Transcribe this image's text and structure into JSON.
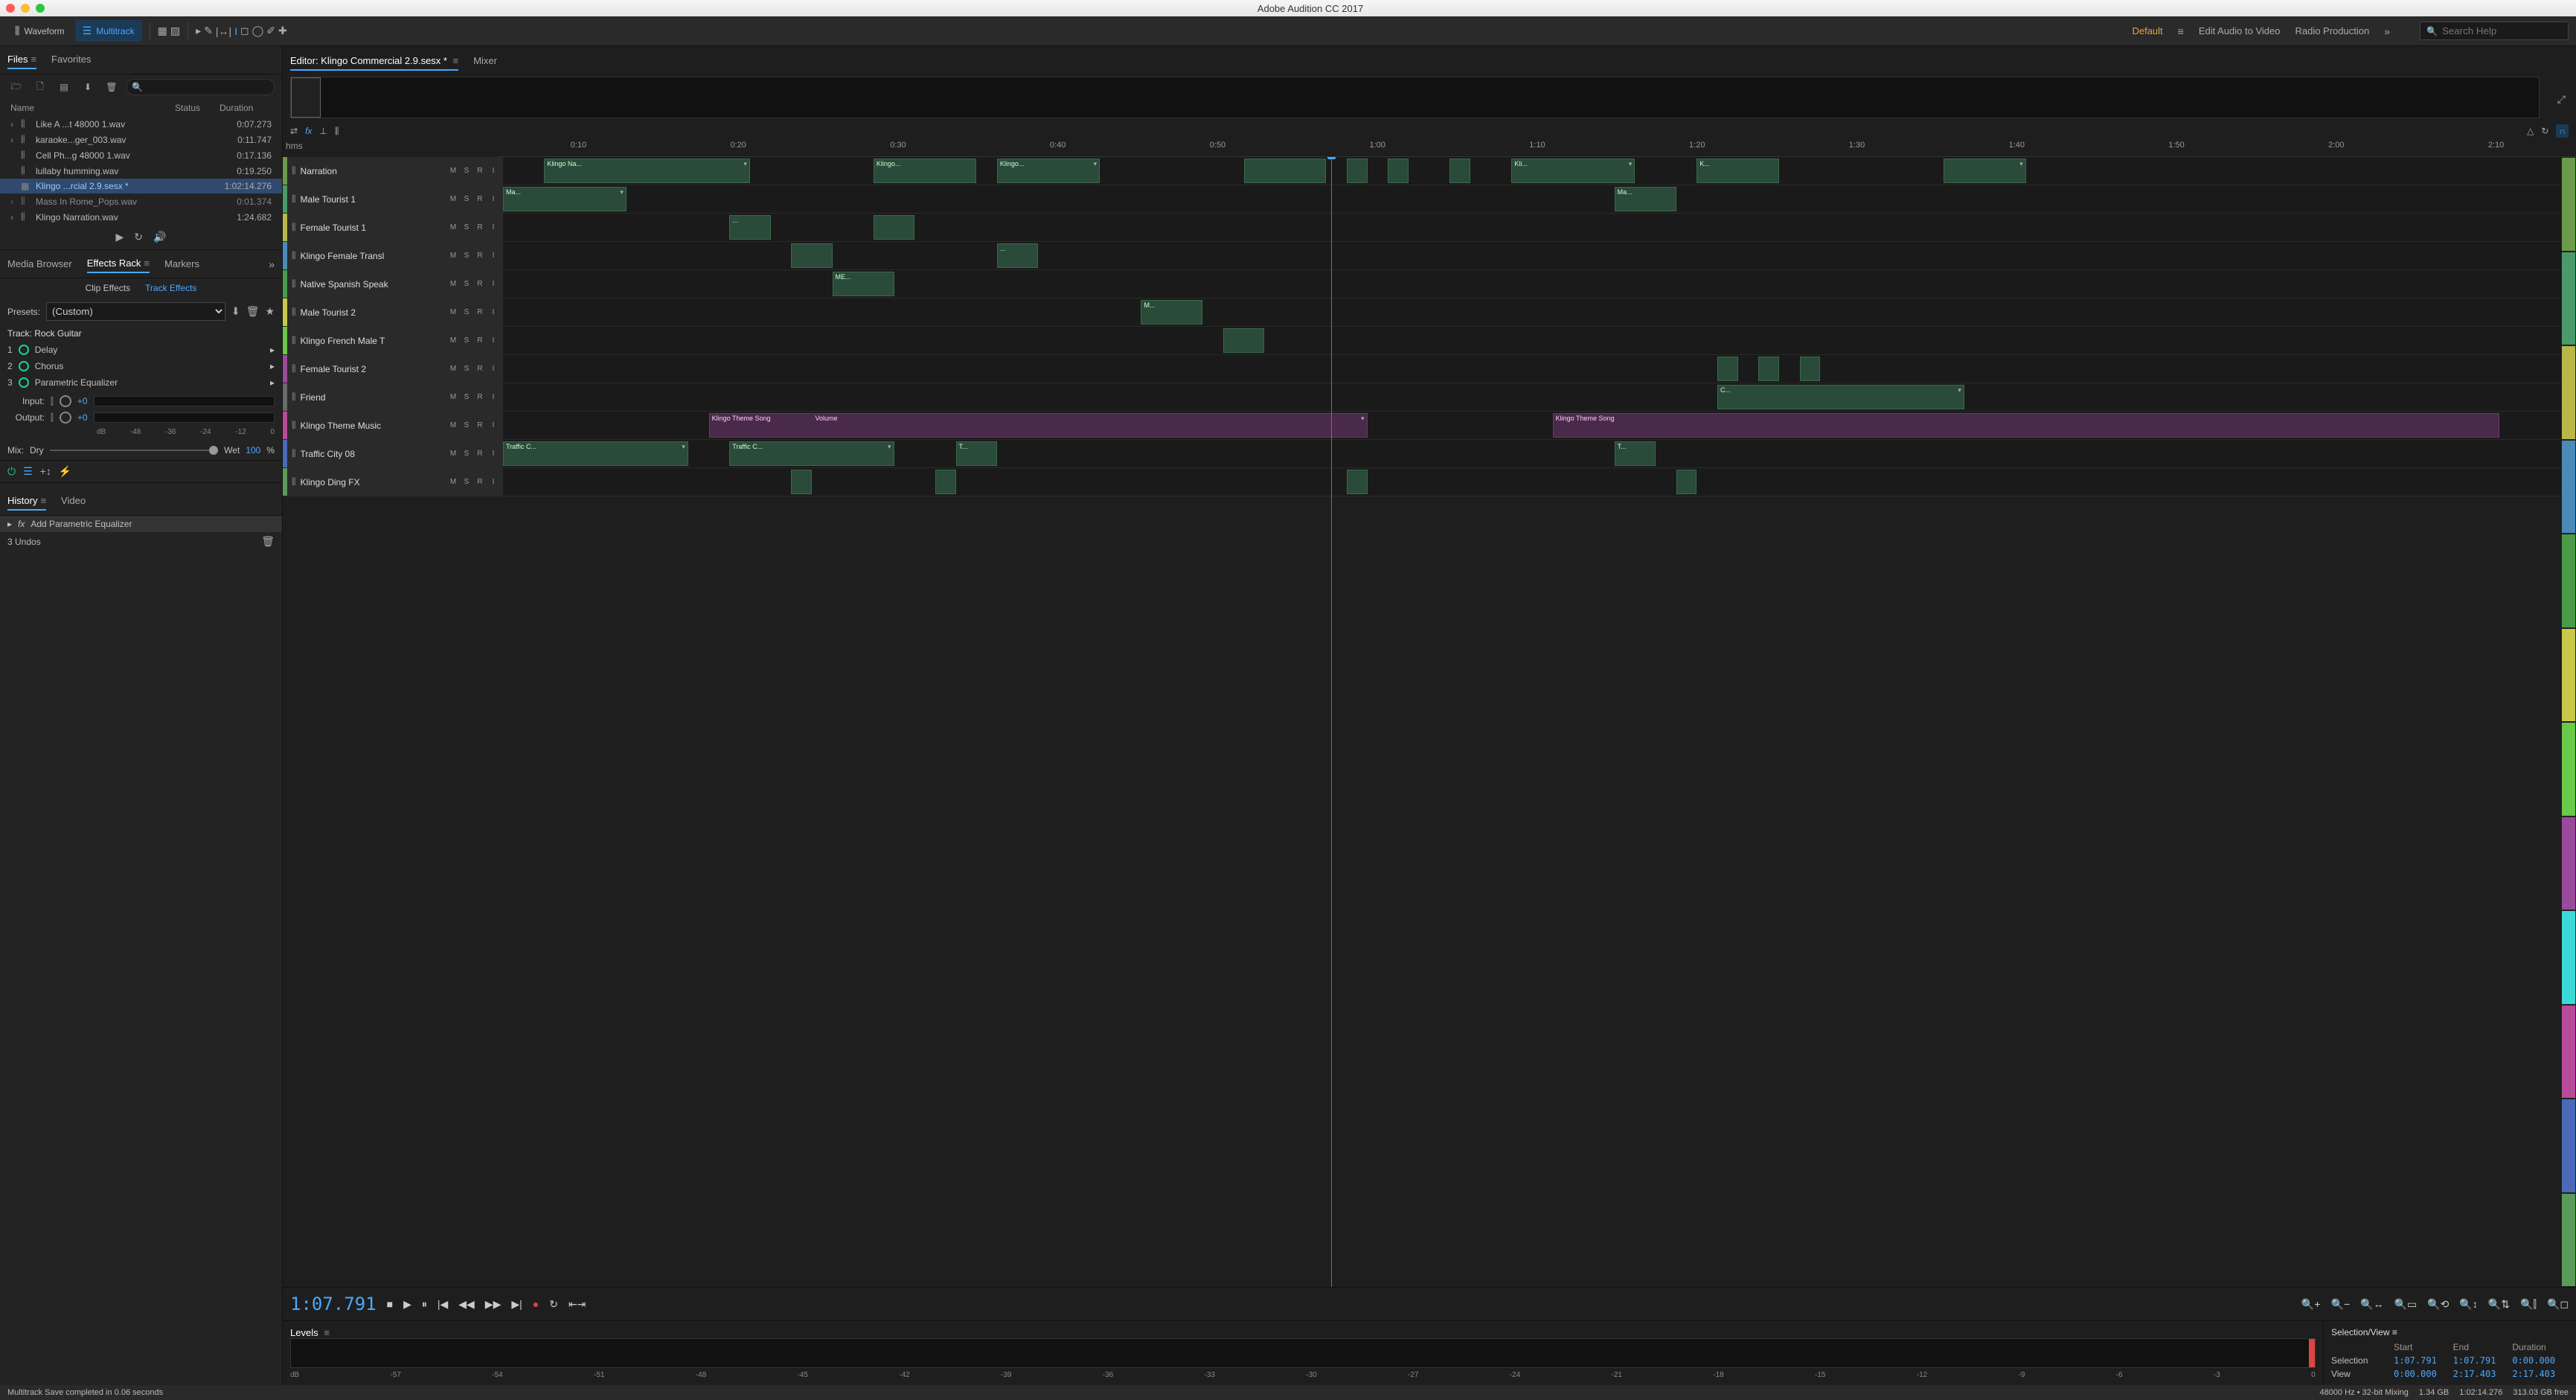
{
  "app": {
    "title": "Adobe Audition CC 2017"
  },
  "toolbar": {
    "waveform": "Waveform",
    "multitrack": "Multitrack",
    "workspaces": [
      "Default",
      "Edit Audio to Video",
      "Radio Production"
    ],
    "active_workspace": "Default",
    "search_placeholder": "Search Help"
  },
  "files_panel": {
    "tabs": [
      "Files",
      "Favorites"
    ],
    "columns": {
      "name": "Name",
      "status": "Status",
      "duration": "Duration"
    },
    "rows": [
      {
        "expand": true,
        "name": "Like A ...t 48000 1.wav",
        "dur": "0:07.273"
      },
      {
        "expand": true,
        "name": "karaoke...ger_003.wav",
        "dur": "0:11.747"
      },
      {
        "expand": false,
        "name": "Cell Ph...g 48000 1.wav",
        "dur": "0:17.136"
      },
      {
        "expand": false,
        "name": "lullaby humming.wav",
        "dur": "0:19.250"
      },
      {
        "expand": false,
        "name": "Klingo ...rcial 2.9.sesx *",
        "dur": "1:02:14.276",
        "sel": true,
        "sesx": true
      },
      {
        "expand": true,
        "name": "Mass In Rome_Pops.wav",
        "dur": "0:01.374",
        "dim": true
      },
      {
        "expand": true,
        "name": "Klingo Narration.wav",
        "dur": "1:24.682"
      }
    ]
  },
  "fx_panel": {
    "tabs": [
      "Media Browser",
      "Effects Rack",
      "Markers"
    ],
    "subtabs": {
      "clip": "Clip Effects",
      "track": "Track Effects"
    },
    "preset_label": "Presets:",
    "preset": "(Custom)",
    "track_label": "Track: Rock Guitar",
    "slots": [
      {
        "n": "1",
        "name": "Delay"
      },
      {
        "n": "2",
        "name": "Chorus"
      },
      {
        "n": "3",
        "name": "Parametric Equalizer"
      }
    ],
    "input": "Input:",
    "output": "Output:",
    "io_val": "+0",
    "db_ticks": [
      "dB",
      "-48",
      "-36",
      "-24",
      "-12",
      "0"
    ],
    "mix": {
      "label": "Mix:",
      "dry": "Dry",
      "wet": "Wet",
      "val": "100",
      "pct": "%"
    }
  },
  "history": {
    "tabs": [
      "History",
      "Video"
    ],
    "item": "Add Parametric Equalizer",
    "undos": "3 Undos"
  },
  "editor": {
    "header": "Editor: Klingo Commercial 2.9.sesx *",
    "mixer": "Mixer",
    "hms": "hms",
    "ruler": [
      "0:10",
      "0:20",
      "0:30",
      "0:40",
      "0:50",
      "1:00",
      "1:10",
      "1:20",
      "1:30",
      "1:40",
      "1:50",
      "2:00",
      "2:10"
    ],
    "tracks": [
      {
        "color": "#6a9a4a",
        "name": "Narration",
        "clips": [
          {
            "x": 2,
            "w": 10,
            "l": "Klingo Na...",
            "dd": true
          },
          {
            "x": 18,
            "w": 5,
            "l": "Klingo..."
          },
          {
            "x": 24,
            "w": 5,
            "l": "Klingo...",
            "dd": true
          },
          {
            "x": 36,
            "w": 4,
            "l": ""
          },
          {
            "x": 41,
            "w": 1,
            "l": ""
          },
          {
            "x": 43,
            "w": 1,
            "l": ""
          },
          {
            "x": 46,
            "w": 1,
            "l": ""
          },
          {
            "x": 49,
            "w": 6,
            "l": "Kli...",
            "dd": true
          },
          {
            "x": 58,
            "w": 4,
            "l": "K..."
          },
          {
            "x": 70,
            "w": 4,
            "l": "",
            "dd": true
          }
        ],
        "h": 38
      },
      {
        "color": "#4a9a6a",
        "name": "Male Tourist 1",
        "clips": [
          {
            "x": 0,
            "w": 6,
            "l": "Ma...",
            "dd": true
          },
          {
            "x": 54,
            "w": 3,
            "l": "Ma..."
          }
        ]
      },
      {
        "color": "#b8b84a",
        "name": "Female Tourist 1",
        "clips": [
          {
            "x": 11,
            "w": 2,
            "l": "..."
          },
          {
            "x": 18,
            "w": 2,
            "l": ""
          }
        ]
      },
      {
        "color": "#4a8ab8",
        "name": "Klingo Female Transl",
        "clips": [
          {
            "x": 14,
            "w": 2,
            "l": ""
          },
          {
            "x": 24,
            "w": 2,
            "l": "..."
          }
        ]
      },
      {
        "color": "#4a9a4a",
        "name": "Native Spanish Speak",
        "clips": [
          {
            "x": 16,
            "w": 3,
            "l": "ME..."
          }
        ]
      },
      {
        "color": "#c8c84a",
        "name": "Male Tourist 2",
        "clips": [
          {
            "x": 31,
            "w": 3,
            "l": "M..."
          }
        ]
      },
      {
        "color": "#6ac84a",
        "name": "Klingo French Male T",
        "clips": [
          {
            "x": 35,
            "w": 2,
            "l": ""
          }
        ]
      },
      {
        "color": "#9a4a9a",
        "name": "Female Tourist 2",
        "clips": [
          {
            "x": 59,
            "w": 1,
            "l": ""
          },
          {
            "x": 61,
            "w": 1,
            "l": ""
          },
          {
            "x": 63,
            "w": 1,
            "l": ""
          }
        ]
      },
      {
        "color": "#6a6a6a",
        "name": "Friend",
        "clips": [
          {
            "x": 59,
            "w": 12,
            "l": "C...",
            "dd": true
          }
        ]
      },
      {
        "color": "#b84a9a",
        "name": "Klingo Theme Music",
        "music": true,
        "clips": [
          {
            "x": 10,
            "w": 32,
            "l": "Klingo Theme Song",
            "vol": "Volume",
            "dd": true
          },
          {
            "x": 51,
            "w": 46,
            "l": "Klingo Theme Song"
          }
        ]
      },
      {
        "color": "#4a6ab8",
        "name": "Traffic City 08",
        "clips": [
          {
            "x": 0,
            "w": 9,
            "l": "Traffic C...",
            "dd": true
          },
          {
            "x": 11,
            "w": 8,
            "l": "Traffic C...",
            "dd": true
          },
          {
            "x": 22,
            "w": 2,
            "l": "T..."
          },
          {
            "x": 54,
            "w": 2,
            "l": "T..."
          }
        ]
      },
      {
        "color": "#5a9a5a",
        "name": "Klingo Ding FX",
        "clips": [
          {
            "x": 14,
            "w": 1,
            "l": ""
          },
          {
            "x": 21,
            "w": 1,
            "l": ""
          },
          {
            "x": 41,
            "w": 1,
            "l": ""
          },
          {
            "x": 57,
            "w": 1,
            "l": ""
          }
        ]
      }
    ],
    "time": "1:07.791"
  },
  "levels": {
    "title": "Levels",
    "db": [
      "dB",
      "-57",
      "-54",
      "-51",
      "-48",
      "-45",
      "-42",
      "-39",
      "-36",
      "-33",
      "-30",
      "-27",
      "-24",
      "-21",
      "-18",
      "-15",
      "-12",
      "-9",
      "-6",
      "-3",
      "0"
    ]
  },
  "selview": {
    "title": "Selection/View",
    "headers": [
      "Start",
      "End",
      "Duration"
    ],
    "rows": [
      {
        "label": "Selection",
        "vals": [
          "1:07.791",
          "1:07.791",
          "0:00.000"
        ]
      },
      {
        "label": "View",
        "vals": [
          "0:00.000",
          "2:17.403",
          "2:17.403"
        ]
      }
    ]
  },
  "status": {
    "msg": "Multitrack Save completed in 0.06 seconds",
    "right": [
      "48000 Hz • 32-bit Mixing",
      "1.34 GB",
      "1:02:14.276",
      "313.03 GB free"
    ]
  }
}
